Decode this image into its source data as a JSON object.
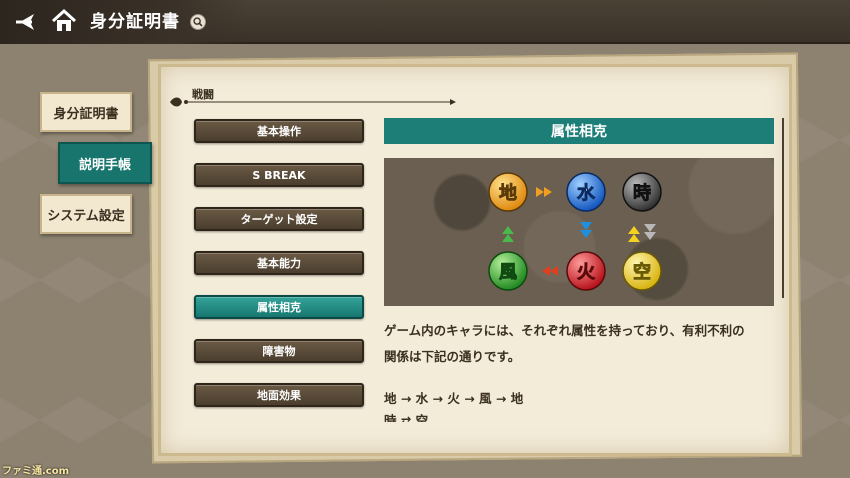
{
  "header": {
    "title": "身分証明書",
    "back_icon": "back-arrow-icon",
    "home_icon": "home-icon",
    "search_icon": "search-icon"
  },
  "side_tabs": [
    {
      "label": "身分証明書",
      "active": false
    },
    {
      "label": "説明手帳",
      "active": true
    },
    {
      "label": "システム設定",
      "active": false
    }
  ],
  "section": {
    "label": "戦闘"
  },
  "menu": [
    {
      "label": "基本操作",
      "selected": false
    },
    {
      "label": "S BREAK",
      "selected": false
    },
    {
      "label": "ターゲット設定",
      "selected": false
    },
    {
      "label": "基本能力",
      "selected": false
    },
    {
      "label": "属性相克",
      "selected": true
    },
    {
      "label": "障害物",
      "selected": false
    },
    {
      "label": "地面効果",
      "selected": false
    }
  ],
  "content": {
    "title": "属性相克",
    "orbs": {
      "earth": "地",
      "water": "水",
      "time": "時",
      "wind": "風",
      "fire": "火",
      "sky": "空"
    },
    "description_line1": "ゲーム内のキャラには、それぞれ属性を持っており、有利不利の",
    "description_line2": "関係は下記の通りです。",
    "cycle1": "地 → 水 → 火 → 風 → 地",
    "cycle2": "時 ⇄ 空"
  },
  "watermark": "ファミ通.com",
  "colors": {
    "accent": "#1d7e77",
    "button_dark": "#4b3e2e",
    "earth": "#f0a020",
    "water": "#1f6fd8",
    "time": "#555555",
    "wind": "#3aa63a",
    "fire": "#d8222a",
    "sky": "#f4d21f"
  }
}
